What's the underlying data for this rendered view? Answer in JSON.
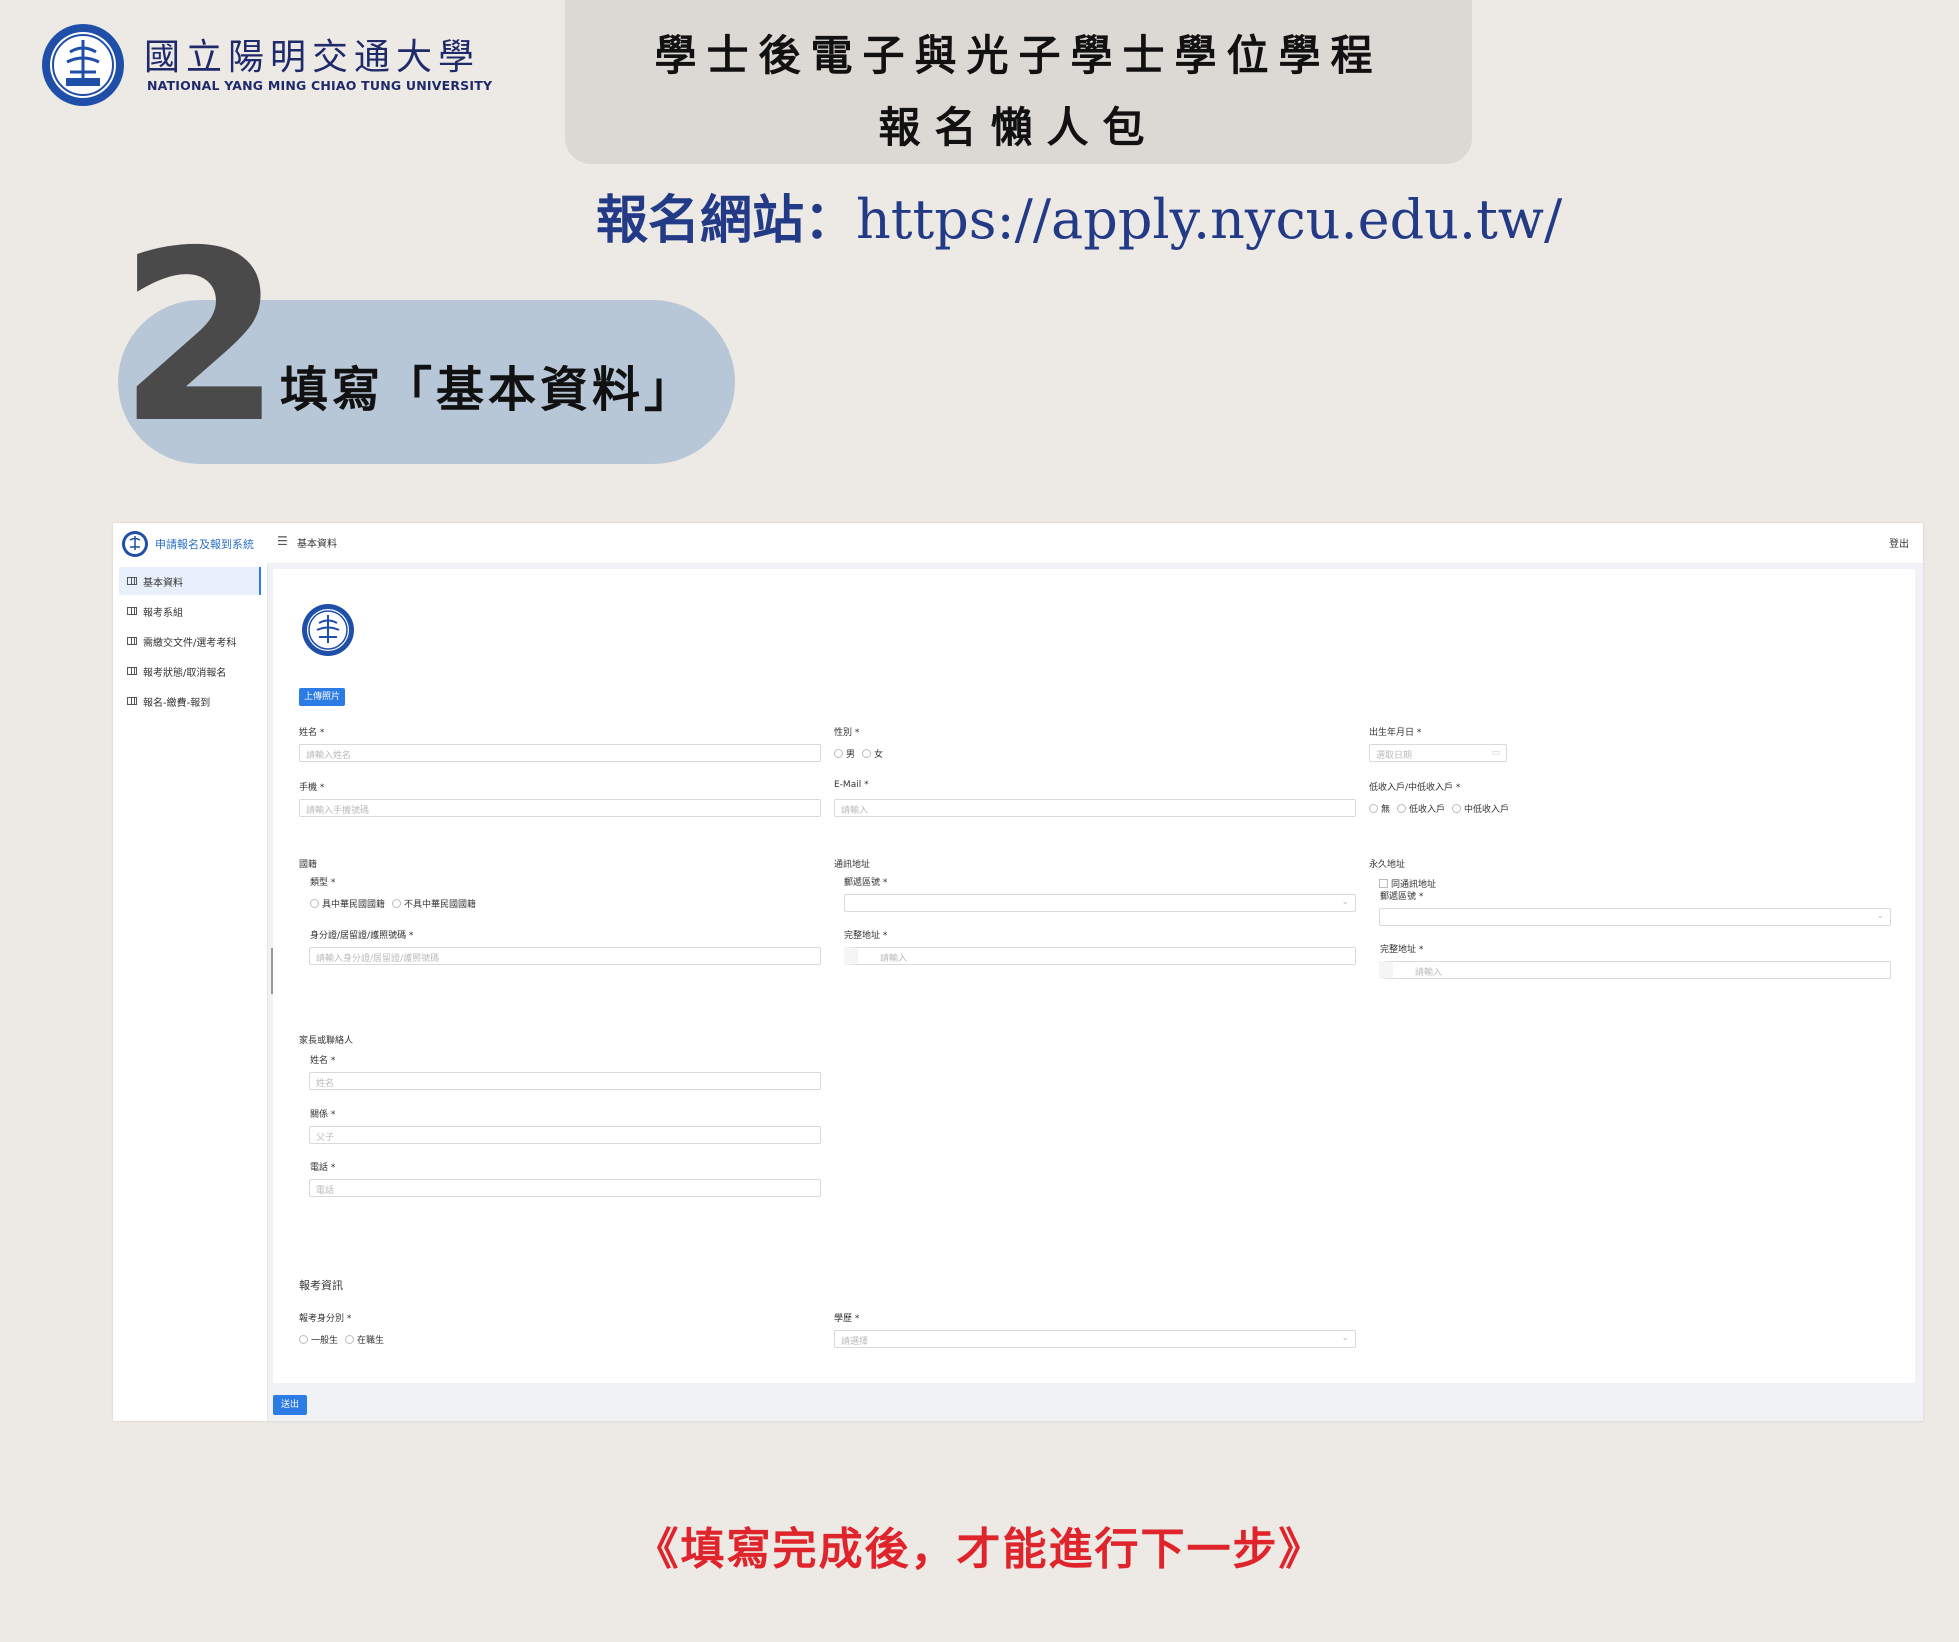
{
  "university": {
    "name_zh": "國立陽明交通大學",
    "name_en": "NATIONAL YANG MING CHIAO TUNG UNIVERSITY"
  },
  "header": {
    "title_line1": "學士後電子與光子學士學位學程",
    "title_line2": "報名懶人包"
  },
  "apply": {
    "label": "報名網站：",
    "url": "https://apply.nycu.edu.tw/"
  },
  "step": {
    "number": "2",
    "text": "填寫「基本資料」"
  },
  "app": {
    "brand": "申請報名及報到系統",
    "breadcrumb": "基本資料",
    "logout": "登出",
    "sidebar": [
      {
        "label": "基本資料",
        "active": true
      },
      {
        "label": "報考系組",
        "active": false
      },
      {
        "label": "需繳交文件/選考考科",
        "active": false
      },
      {
        "label": "報考狀態/取消報名",
        "active": false
      },
      {
        "label": "報名-繳費-報到",
        "active": false
      }
    ],
    "upload_photo": "上傳照片",
    "form": {
      "name": {
        "label": "姓名 *",
        "placeholder": "請輸入姓名"
      },
      "gender": {
        "label": "性別 *",
        "options": [
          "男",
          "女"
        ]
      },
      "birthday": {
        "label": "出生年月日 *",
        "placeholder": "選取日期"
      },
      "mobile": {
        "label": "手機 *",
        "placeholder": "請輸入手機號碼"
      },
      "email": {
        "label": "E-Mail *",
        "placeholder": "請輸入"
      },
      "income": {
        "label": "低收入戶/中低收入戶 *",
        "options": [
          "無",
          "低收入戶",
          "中低收入戶"
        ]
      },
      "nationality": {
        "label": "國籍",
        "type_label": "類型 *",
        "options": [
          "具中華民國國籍",
          "不具中華民國國籍"
        ],
        "id_label": "身分證/居留證/護照號碼 *",
        "id_placeholder": "請輸入身分證/居留證/護照號碼"
      },
      "mailing": {
        "label": "通訊地址",
        "zip_label": "郵遞區號 *",
        "addr_label": "完整地址 *",
        "addr_placeholder": "請輸入"
      },
      "permanent": {
        "label": "永久地址",
        "same_label": "同通訊地址",
        "zip_label": "郵遞區號 *",
        "addr_label": "完整地址 *",
        "addr_placeholder": "請輸入"
      },
      "guardian": {
        "label": "家長或聯絡人",
        "name_label": "姓名 *",
        "name_placeholder": "姓名",
        "relation_label": "關係 *",
        "relation_placeholder": "父子",
        "phone_label": "電話 *",
        "phone_placeholder": "電話"
      }
    },
    "exam_info": {
      "title": "報考資訊",
      "identity_label": "報考身分別 *",
      "identity_options": [
        "一般生",
        "在職生"
      ],
      "education_label": "學歷 *",
      "education_placeholder": "請選擇"
    },
    "submit": "送出"
  },
  "footer": {
    "note": "《填寫完成後，才能進行下一步》"
  },
  "colors": {
    "background": "#ede9e5",
    "title_box": "#dcd8d3",
    "url_blue": "#233b86",
    "step_pill": "#b7c7d7",
    "note_red": "#e0242c",
    "button_blue": "#2d7be5"
  }
}
